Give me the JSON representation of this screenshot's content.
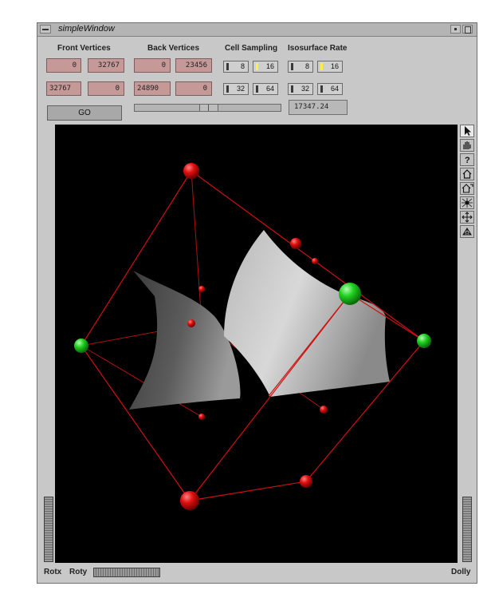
{
  "window": {
    "title": "simpleWindow"
  },
  "headers": {
    "front_vertices": "Front Vertices",
    "back_vertices": "Back Vertices",
    "cell_sampling": "Cell Sampling",
    "isosurface_rate": "Isosurface Rate"
  },
  "front_vertices": {
    "r1c1": "0",
    "r1c2": "32767",
    "r2c1": "32767",
    "r2c2": "0"
  },
  "back_vertices": {
    "r1c1": "0",
    "r1c2": "23456",
    "r2c1": "24890",
    "r2c2": "0"
  },
  "go_label": "GO",
  "cell_sampling": {
    "options": [
      {
        "label": "8",
        "selected": false
      },
      {
        "label": "16",
        "selected": true
      },
      {
        "label": "32",
        "selected": false
      },
      {
        "label": "64",
        "selected": false
      }
    ]
  },
  "isosurface_rate": {
    "options": [
      {
        "label": "8",
        "selected": false
      },
      {
        "label": "16",
        "selected": true
      },
      {
        "label": "32",
        "selected": false
      },
      {
        "label": "64",
        "selected": false
      }
    ],
    "value": "17347.24"
  },
  "slider": {
    "position_fraction": 0.51
  },
  "viewer_tools": [
    "pointer-icon",
    "hand-icon",
    "help-icon",
    "home-icon",
    "set-home-icon",
    "view-all-icon",
    "seek-icon",
    "perspective-icon"
  ],
  "thumbwheels": {
    "rotx": "Rotx",
    "roty": "Roty",
    "dolly": "Dolly"
  },
  "colors": {
    "vertex_red": "#e01010",
    "vertex_green": "#20d020",
    "edge": "#c01010",
    "field": "#c69999"
  }
}
